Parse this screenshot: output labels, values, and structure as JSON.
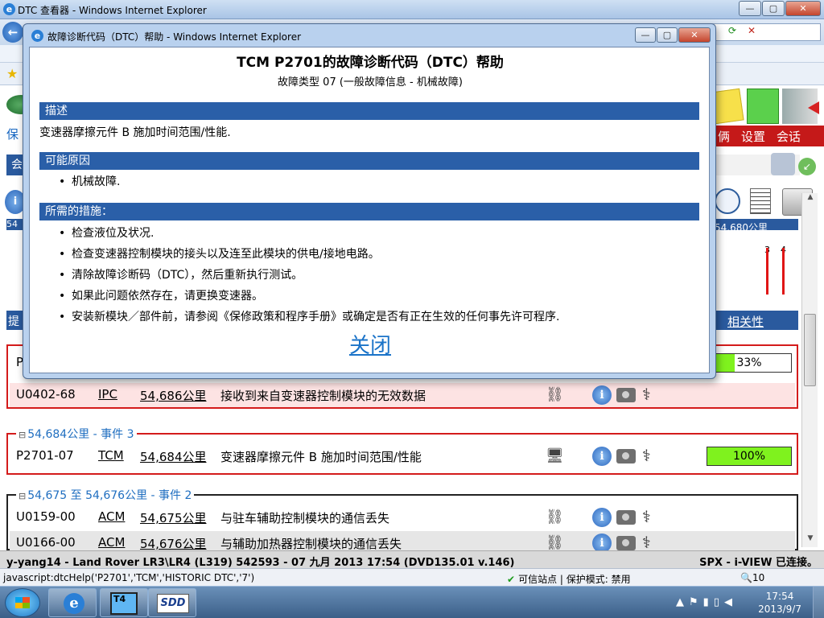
{
  "outer_window": {
    "title": "DTC 查看器 - Windows Internet Explorer",
    "controls": {
      "minimize": "—",
      "maximize": "▢",
      "close": "✕"
    }
  },
  "app": {
    "nav_left": "保",
    "section_left": "会",
    "nav_tabs": [
      "俩",
      "设置",
      "会话"
    ],
    "timeline_left": "54",
    "timeline_right_label": "54,680公里",
    "timeline_markers": [
      "3",
      "4"
    ],
    "list_header_left": "提",
    "list_header_right": "相关性",
    "groups": [
      {
        "title": "",
        "rows": [
          {
            "code": "P",
            "module": "",
            "km": "",
            "desc": "",
            "progress_text": "33%",
            "progress": 0.33
          },
          {
            "code": "U0402-68",
            "module": "IPC",
            "km": "54,686公里",
            "desc": "接收到来自变速器控制模块的无效数据"
          }
        ]
      },
      {
        "title": "54,684公里 - 事件 3",
        "rows": [
          {
            "code": "P2701-07",
            "module": "TCM",
            "km": "54,684公里",
            "desc": "变速器摩擦元件 B 施加时间范围/性能",
            "progress_text": "100%",
            "progress": 1.0
          }
        ]
      },
      {
        "title": "54,675 至 54,676公里 - 事件 2",
        "rows": [
          {
            "code": "U0159-00",
            "module": "ACM",
            "km": "54,675公里",
            "desc": "与驻车辅助控制模块的通信丢失"
          },
          {
            "code": "U0166-00",
            "module": "ACM",
            "km": "54,676公里",
            "desc": "与辅助加热器控制模块的通信丢失"
          }
        ]
      }
    ],
    "footer_left": "y-yang14 - Land Rover LR3\\LR4 (L319) 542593 - 07 九月 2013 17:54 (DVD135.01 v.146)",
    "footer_right": "SPX - i-VIEW 已连接。"
  },
  "ie_status": {
    "url": "javascript:dtcHelp('P2701','TCM','HISTORIC DTC','7')",
    "trust": "可信站点 | 保护模式: 禁用",
    "zoom": "10"
  },
  "taskbar": {
    "t4_label": "T4",
    "sdd_label": "SDD",
    "time": "17:54",
    "date": "2013/9/7"
  },
  "popup": {
    "window_title": "故障诊断代码（DTC）帮助 - Windows Internet Explorer",
    "title": "TCM P2701的故障诊断代码（DTC）帮助",
    "subtitle": "故障类型  07 (一般故障信息  - 机械故障)",
    "description_heading": "描述",
    "description_text": "变速器摩擦元件  B 施加时间范围/性能.",
    "causes_heading": "可能原因",
    "causes": [
      "机械故障."
    ],
    "actions_heading": "所需的措施：",
    "actions": [
      "检查液位及状况.",
      "检查变速器控制模块的接头以及连至此模块的供电/接地电路。",
      "清除故障诊断码（DTC），然后重新执行测试。",
      "如果此问题依然存在，请更换变速器。",
      "安装新模块／部件前，请参阅《保修政策和程序手册》或确定是否有正在生效的任何事先许可程序."
    ],
    "close_label": "关闭"
  }
}
